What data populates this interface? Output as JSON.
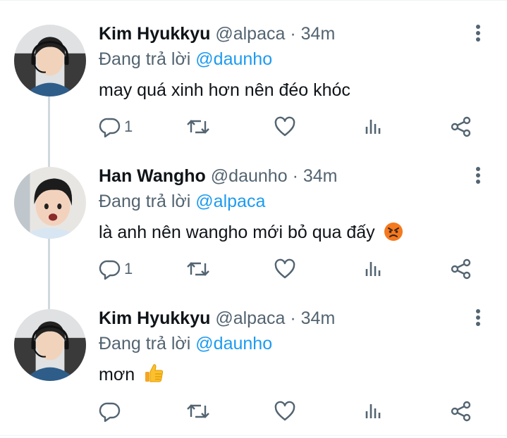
{
  "tweets": [
    {
      "name": "Kim Hyukkyu",
      "handle": "@alpaca",
      "sep": "·",
      "time": "34m",
      "reply_prefix": "Đang trả lời",
      "reply_to": "@daunho",
      "text": "may quá xinh hơn nên đéo khóc",
      "emoji": "",
      "reply_count": "1",
      "avatar": "avatar-alpaca"
    },
    {
      "name": "Han Wangho",
      "handle": "@daunho",
      "sep": "·",
      "time": "34m",
      "reply_prefix": "Đang trả lời",
      "reply_to": "@alpaca",
      "text": "là anh nên wangho mới bỏ qua đấy",
      "emoji": "angry-face-emoji",
      "reply_count": "1",
      "avatar": "avatar-daunho"
    },
    {
      "name": "Kim Hyukkyu",
      "handle": "@alpaca",
      "sep": "·",
      "time": "34m",
      "reply_prefix": "Đang trả lời",
      "reply_to": "@daunho",
      "text": "mơn",
      "emoji": "thumbs-up-emoji",
      "reply_count": "",
      "avatar": "avatar-alpaca"
    }
  ],
  "icons": {
    "reply": "reply-icon",
    "retweet": "retweet-icon",
    "like": "like-icon",
    "views": "views-icon",
    "share": "share-icon",
    "more": "more-vertical-icon"
  },
  "colors": {
    "text": "#0f1419",
    "secondary": "#536471",
    "mention": "#1d9bf0",
    "thread_line": "#cfd9de"
  }
}
